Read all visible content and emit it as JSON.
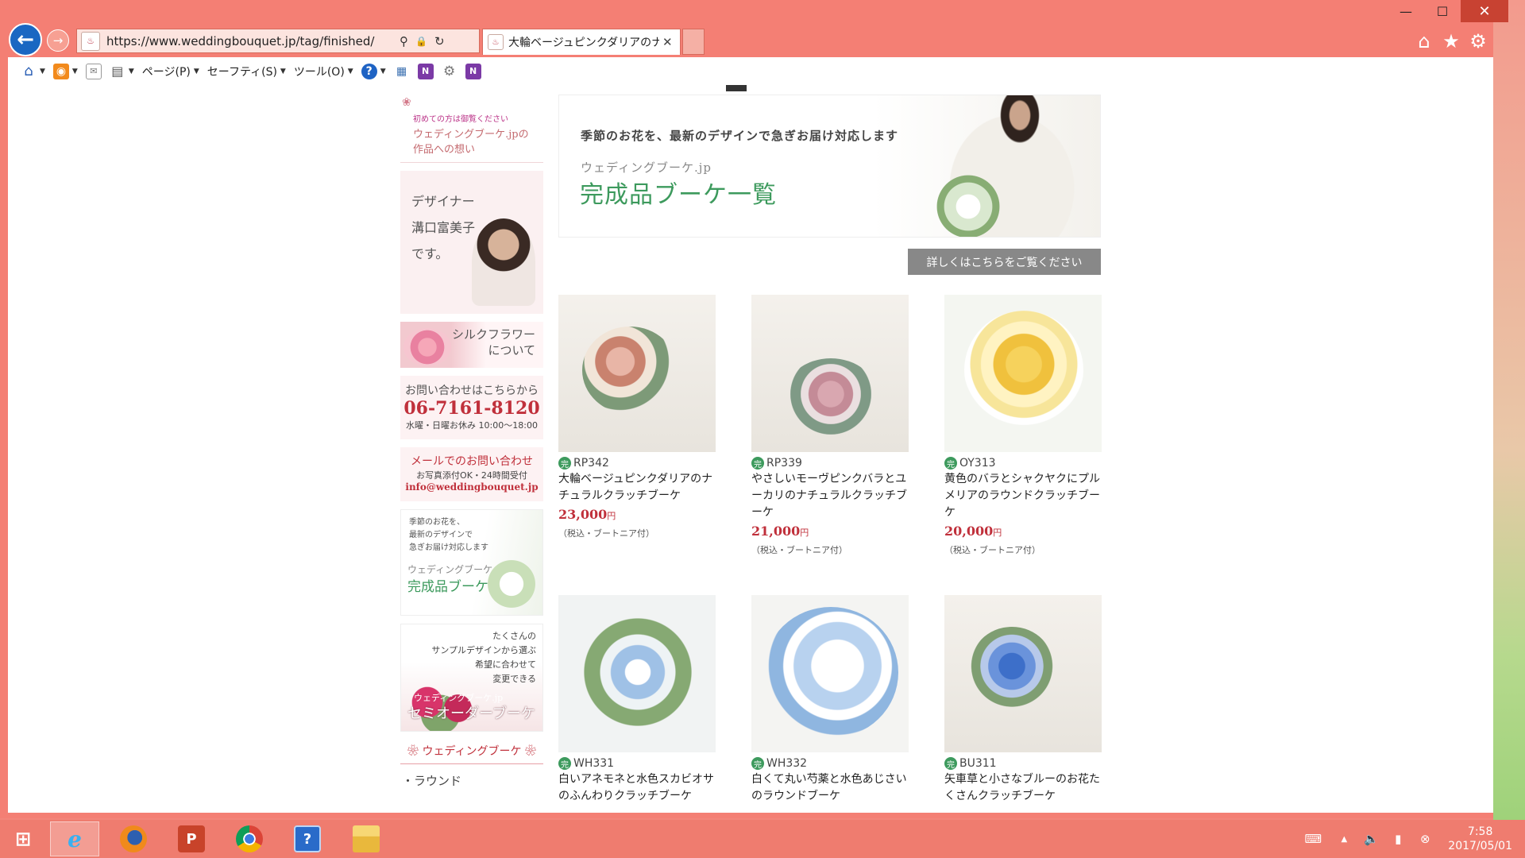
{
  "browser": {
    "url": "https://www.weddingbouquet.jp/tag/finished/",
    "tab_title": "大輪ベージュピンクダリアのナチ...",
    "favicon_label": "♨"
  },
  "icons": {
    "back": "←",
    "forward": "→",
    "search": "⚲",
    "lock": "🔒",
    "refresh": "↻",
    "home": "⌂",
    "star": "★",
    "gear": "⚙",
    "close": "✕",
    "minimize": "—",
    "maximize": "☐"
  },
  "command_bar": {
    "page": "ページ(P)",
    "safety": "セーフティ(S)",
    "tools": "ツール(O)",
    "help": "?"
  },
  "sidebar": {
    "intro_small": "初めての方は御覧ください",
    "intro_line1": "ウェディングブーケ.jpの",
    "intro_line2": "作品への想い",
    "designer_line1": "デザイナー",
    "designer_line2": "溝口富美子",
    "designer_line3": "です。",
    "silk_line1": "シルクフラワー",
    "silk_line2": "について",
    "contact_label": "お問い合わせはこちらから",
    "contact_phone": "06-7161-8120",
    "contact_hours": "水曜・日曜お休み 10:00～18:00",
    "mail_label": "メールでのお問い合わせ",
    "mail_note": "お写真添付OK・24時間受付",
    "mail_address": "info@weddingbouquet.jp",
    "finished_line1": "季節のお花を、",
    "finished_line2": "最新のデザインで",
    "finished_line3": "急ぎお届け対応します",
    "finished_sub": "ウェディングブーケ.jp",
    "finished_title": "完成品ブーケ一覧",
    "semi_line1": "たくさんの",
    "semi_line2": "サンプルデザインから選ぶ",
    "semi_line3": "希望に合わせて",
    "semi_line4": "変更できる",
    "semi_sub": "ウェディングブーケ.jp",
    "semi_title": "セミオーダーブーケ",
    "heading": "❀ ウェディングブーケ ❀",
    "list_item": "・ラウンド"
  },
  "banner": {
    "lead": "季節のお花を、最新のデザインで急ぎお届け対応します",
    "sub": "ウェディングブーケ.jp",
    "title": "完成品ブーケ一覧"
  },
  "more_button": "詳しくはこちらをご覧ください",
  "badge": "完",
  "price_unit": "円",
  "price_note": "（税込・ブートニア付）",
  "products": [
    {
      "code": "RP342",
      "name": "大輪ベージュピンクダリアのナチュラルクラッチブーケ",
      "price": "23,000"
    },
    {
      "code": "RP339",
      "name": "やさしいモーヴピンクバラとユーカリのナチュラルクラッチブーケ",
      "price": "21,000"
    },
    {
      "code": "OY313",
      "name": "黄色のバラとシャクヤクにプルメリアのラウンドクラッチブーケ",
      "price": "20,000"
    },
    {
      "code": "WH331",
      "name": "白いアネモネと水色スカビオサのふんわりクラッチブーケ",
      "price": ""
    },
    {
      "code": "WH332",
      "name": "白くて丸い芍薬と水色あじさいのラウンドブーケ",
      "price": ""
    },
    {
      "code": "BU311",
      "name": "矢車草と小さなブルーのお花たくさんクラッチブーケ",
      "price": ""
    }
  ],
  "taskbar": {
    "powerpoint": "P",
    "help": "?",
    "clock_time": "7:58",
    "clock_date": "2017/05/01"
  },
  "colors": {
    "accent_green": "#3d9a5d",
    "price_red": "#c0303b",
    "chrome_salmon": "#f47f74"
  }
}
